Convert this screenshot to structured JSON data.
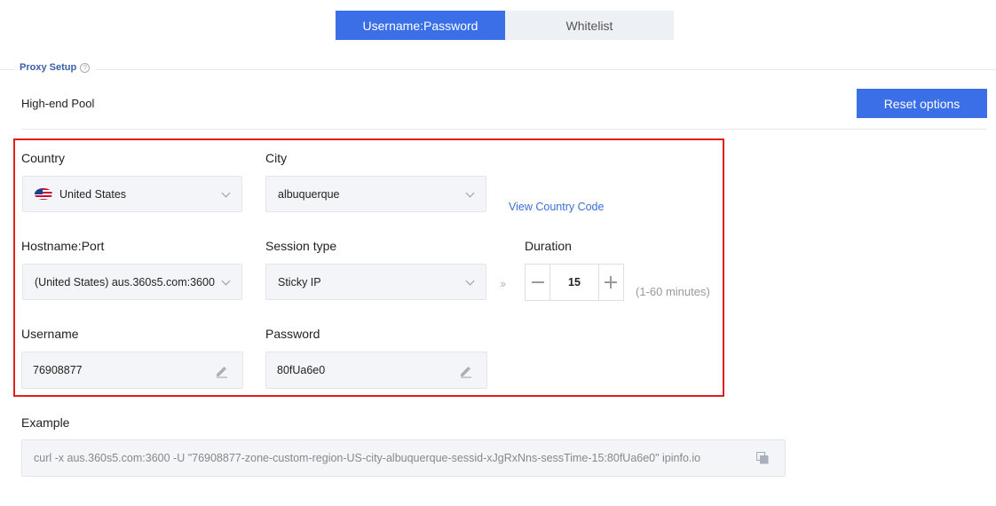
{
  "tabs": [
    {
      "label": "Username:Password",
      "active": true
    },
    {
      "label": "Whitelist",
      "active": false
    }
  ],
  "section": {
    "title": "Proxy Setup"
  },
  "pool": {
    "label": "High-end Pool"
  },
  "reset_button": {
    "label": "Reset options"
  },
  "form": {
    "country": {
      "label": "Country",
      "value": "United States"
    },
    "city": {
      "label": "City",
      "value": "albuquerque"
    },
    "view_country_code": "View Country Code",
    "hostname": {
      "label": "Hostname:Port",
      "value": "(United States) aus.360s5.com:3600"
    },
    "session_type": {
      "label": "Session type",
      "value": "Sticky IP"
    },
    "duration": {
      "label": "Duration",
      "value": "15",
      "range_hint": "(1-60 minutes)"
    },
    "username": {
      "label": "Username",
      "value": "76908877"
    },
    "password": {
      "label": "Password",
      "value": "80fUa6e0"
    }
  },
  "example": {
    "label": "Example",
    "command": "curl -x aus.360s5.com:3600 -U \"76908877-zone-custom-region-US-city-albuquerque-sessid-xJgRxNns-sessTime-15:80fUa6e0\" ipinfo.io"
  },
  "colors": {
    "accent": "#3b6fe8",
    "highlight_border": "#e01e1e",
    "link": "#3a6fd8"
  }
}
